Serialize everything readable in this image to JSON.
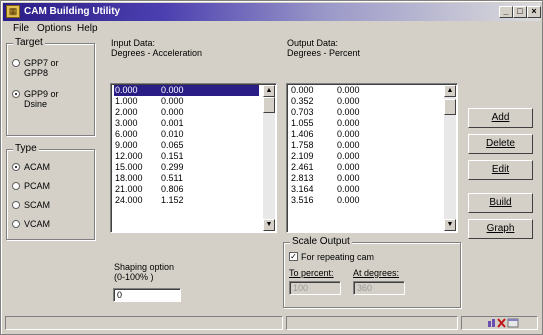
{
  "window": {
    "title": "CAM Building Utility",
    "app_icon": "app-icon"
  },
  "title_buttons": {
    "minimize": "_",
    "maximize": "□",
    "close": "×"
  },
  "menu": {
    "items": [
      "File",
      "Options",
      "Help"
    ]
  },
  "target": {
    "legend": "Target",
    "options": [
      {
        "label_line1": "GPP7 or",
        "label_line2": "GPP8",
        "selected": false
      },
      {
        "label_line1": "GPP9 or",
        "label_line2": "Dsine",
        "selected": true
      }
    ]
  },
  "type": {
    "legend": "Type",
    "options": [
      {
        "label": "ACAM",
        "selected": true
      },
      {
        "label": "PCAM",
        "selected": false
      },
      {
        "label": "SCAM",
        "selected": false
      },
      {
        "label": "VCAM",
        "selected": false
      }
    ]
  },
  "input_data": {
    "title_line1": "Input Data:",
    "title_line2": "Degrees - Acceleration",
    "rows": [
      [
        "0.000",
        "0.000"
      ],
      [
        "1.000",
        "0.000"
      ],
      [
        "2.000",
        "0.000"
      ],
      [
        "3.000",
        "0.001"
      ],
      [
        "6.000",
        "0.010"
      ],
      [
        "9.000",
        "0.065"
      ],
      [
        "12.000",
        "0.151"
      ],
      [
        "15.000",
        "0.299"
      ],
      [
        "18.000",
        "0.511"
      ],
      [
        "21.000",
        "0.806"
      ],
      [
        "24.000",
        "1.152"
      ]
    ]
  },
  "output_data": {
    "title_line1": "Output Data:",
    "title_line2": "Degrees - Percent",
    "rows": [
      [
        "0.000",
        "0.000"
      ],
      [
        "0.352",
        "0.000"
      ],
      [
        "0.703",
        "0.000"
      ],
      [
        "1.055",
        "0.000"
      ],
      [
        "1.406",
        "0.000"
      ],
      [
        "1.758",
        "0.000"
      ],
      [
        "2.109",
        "0.000"
      ],
      [
        "2.461",
        "0.000"
      ],
      [
        "2.813",
        "0.000"
      ],
      [
        "3.164",
        "0.000"
      ],
      [
        "3.516",
        "0.000"
      ]
    ]
  },
  "buttons": {
    "add": "Add",
    "delete": "Delete",
    "edit": "Edit",
    "build": "Build",
    "graph": "Graph"
  },
  "shaping": {
    "label_line1": "Shaping option",
    "label_line2": "(0-100% )",
    "value": "0"
  },
  "scale_output": {
    "legend": "Scale Output",
    "checkbox_label": "For repeating cam",
    "checked": true,
    "to_percent_label": "To percent:",
    "to_percent_value": "100",
    "at_degrees_label": "At degrees:",
    "at_degrees_value": "360"
  },
  "colors": {
    "selection": "#2a1d86",
    "face": "#d4d0c8"
  }
}
